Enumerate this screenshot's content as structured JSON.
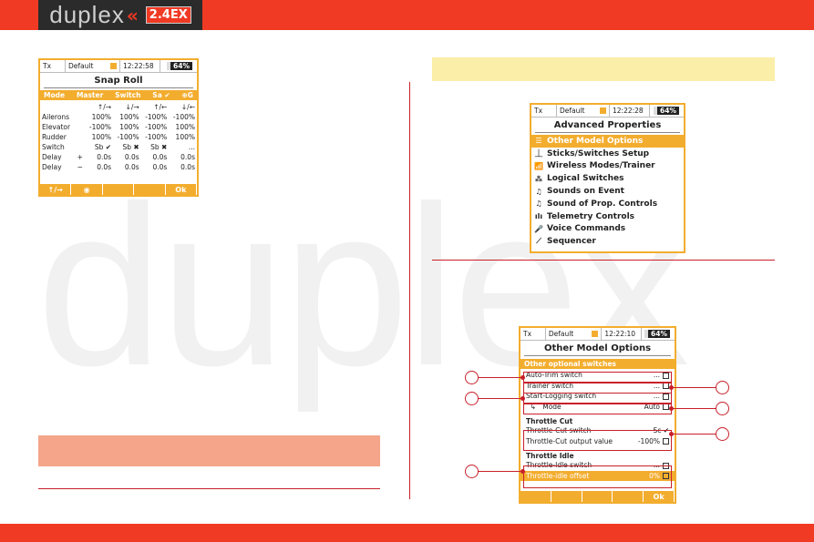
{
  "header": {
    "logo_text": "duplex",
    "logo_badge": "2.4EX",
    "colors": {
      "brand_red": "#f03a24",
      "accent_orange": "#f3ad2e"
    }
  },
  "snap_roll": {
    "status": {
      "tx": "Tx",
      "model": "Default",
      "time": "12:22:58",
      "battery": "64%"
    },
    "title": "Snap Roll",
    "mode_bar": {
      "mode": "Mode",
      "master": "Master",
      "switch": "Switch",
      "sw_value": "Sa ✔",
      "icon": "⊕G"
    },
    "col_headers": [
      "↑/→",
      "↓/→",
      "↑/←",
      "↓/←"
    ],
    "rows": [
      {
        "label": "Ailerons",
        "sign": "",
        "values": [
          "100%",
          "100%",
          "-100%",
          "-100%"
        ]
      },
      {
        "label": "Elevator",
        "sign": "",
        "values": [
          "-100%",
          "100%",
          "-100%",
          "100%"
        ]
      },
      {
        "label": "Rudder",
        "sign": "",
        "values": [
          "100%",
          "-100%",
          "-100%",
          "100%"
        ]
      },
      {
        "label": "Switch",
        "sign": "",
        "values": [
          "Sb ✔",
          "Sb ✖",
          "Sb ✖",
          "..."
        ]
      },
      {
        "label": "Delay",
        "sign": "+",
        "values": [
          "0.0s",
          "0.0s",
          "0.0s",
          "0.0s"
        ]
      },
      {
        "label": "Delay",
        "sign": "−",
        "values": [
          "0.0s",
          "0.0s",
          "0.0s",
          "0.0s"
        ]
      }
    ],
    "footer": [
      "↑/→",
      "",
      "",
      "",
      "Ok"
    ]
  },
  "advanced": {
    "status": {
      "tx": "Tx",
      "model": "Default",
      "time": "12:22:28",
      "battery": "64%"
    },
    "title": "Advanced Properties",
    "items": [
      {
        "label": "Other Model Options",
        "icon": "☰"
      },
      {
        "label": "Sticks/Switches Setup",
        "icon": "⏊"
      },
      {
        "label": "Wireless Modes/Trainer",
        "icon": "📶"
      },
      {
        "label": "Logical Switches",
        "icon": "⁂"
      },
      {
        "label": "Sounds on Event",
        "icon": "♫"
      },
      {
        "label": "Sound of Prop. Controls",
        "icon": "♫"
      },
      {
        "label": "Telemetry Controls",
        "icon": "ılı"
      },
      {
        "label": "Voice Commands",
        "icon": "🎤"
      },
      {
        "label": "Sequencer",
        "icon": "⟋"
      }
    ]
  },
  "other_options": {
    "status": {
      "tx": "Tx",
      "model": "Default",
      "time": "12:22:10",
      "battery": "64%"
    },
    "title": "Other Model Options",
    "section1": "Other optional switches",
    "rows1": [
      {
        "label": "Auto-Trim switch",
        "value": "..."
      },
      {
        "label": "Trainer switch",
        "value": "..."
      },
      {
        "label": "Start-Logging switch",
        "value": "..."
      },
      {
        "label": "Mode",
        "value": "Auto"
      }
    ],
    "section2": "Throttle Cut",
    "rows2": [
      {
        "label": "Throttle-Cut switch",
        "value": "Sc ✔"
      },
      {
        "label": "Throttle-Cut output value",
        "value": "-100%"
      }
    ],
    "section3": "Throttle Idle",
    "rows3": [
      {
        "label": "Throttle-Idle switch",
        "value": "..."
      },
      {
        "label": "Throttle-idle offset",
        "value": "0%"
      }
    ],
    "footer": [
      "",
      "",
      "",
      "",
      "Ok"
    ]
  }
}
